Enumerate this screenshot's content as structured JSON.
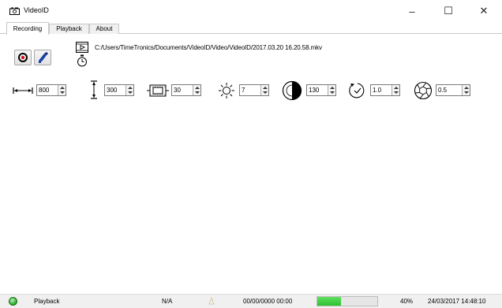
{
  "window": {
    "title": "VideoID",
    "minimize": "–",
    "maximize": "☐",
    "close": "✕"
  },
  "tabs": [
    {
      "label": "Recording",
      "active": true
    },
    {
      "label": "Playback",
      "active": false
    },
    {
      "label": "About",
      "active": false
    }
  ],
  "recording": {
    "record_icon": "record-icon",
    "camera_icon": "camera-icon",
    "play_icon": "play-file-icon",
    "timer_icon": "stopwatch-icon",
    "output_path": "C:/Users/TimeTronics/Documents/VideoID/Video/VideoID/2017.03.20 16.20.58.mkv",
    "controls": [
      {
        "name": "width",
        "icon": "width-icon",
        "value": "800"
      },
      {
        "name": "height",
        "icon": "height-icon",
        "value": "300"
      },
      {
        "name": "framerate",
        "icon": "film-frame-icon",
        "value": "30"
      },
      {
        "name": "brightness",
        "icon": "brightness-icon",
        "value": "7"
      },
      {
        "name": "contrast",
        "icon": "contrast-icon",
        "value": "130"
      },
      {
        "name": "exposure",
        "icon": "exposure-timer-icon",
        "value": "1.0"
      },
      {
        "name": "aperture",
        "icon": "aperture-icon",
        "value": "0.5"
      }
    ]
  },
  "status": {
    "led_color": "#22aa22",
    "mode": "Playback",
    "na": "N/A",
    "timecode": "00/00/0000 00:00",
    "progress_percent": 40,
    "progress_label": "40%",
    "datetime": "24/03/2017 14:48:10"
  }
}
